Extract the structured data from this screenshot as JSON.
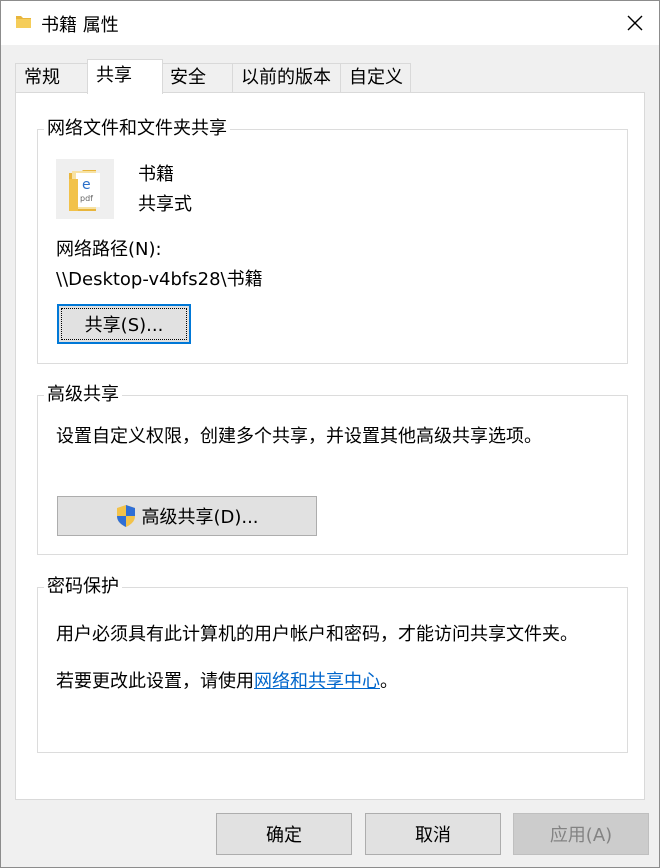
{
  "window": {
    "title": "书籍 属性",
    "close_icon": "close-icon"
  },
  "tabs": [
    {
      "label": "常规"
    },
    {
      "label": "共享"
    },
    {
      "label": "安全"
    },
    {
      "label": "以前的版本"
    },
    {
      "label": "自定义"
    }
  ],
  "network_share": {
    "legend": "网络文件和文件夹共享",
    "folder_name": "书籍",
    "share_status": "共享式",
    "path_label": "网络路径(N):",
    "path_value": "\\\\Desktop-v4bfs28\\书籍",
    "share_button": "共享(S)..."
  },
  "advanced_share": {
    "legend": "高级共享",
    "description": "设置自定义权限，创建多个共享，并设置其他高级共享选项。",
    "button": "高级共享(D)..."
  },
  "password_protection": {
    "legend": "密码保护",
    "description": "用户必须具有此计算机的用户帐户和密码，才能访问共享文件夹。",
    "change_prefix": "若要更改此设置，请使用",
    "change_link": "网络和共享中心",
    "change_suffix": "。"
  },
  "footer": {
    "ok": "确定",
    "cancel": "取消",
    "apply": "应用(A)"
  },
  "colors": {
    "link": "#0066cc",
    "accent": "#0078d7",
    "folder": "#e8b53c"
  }
}
